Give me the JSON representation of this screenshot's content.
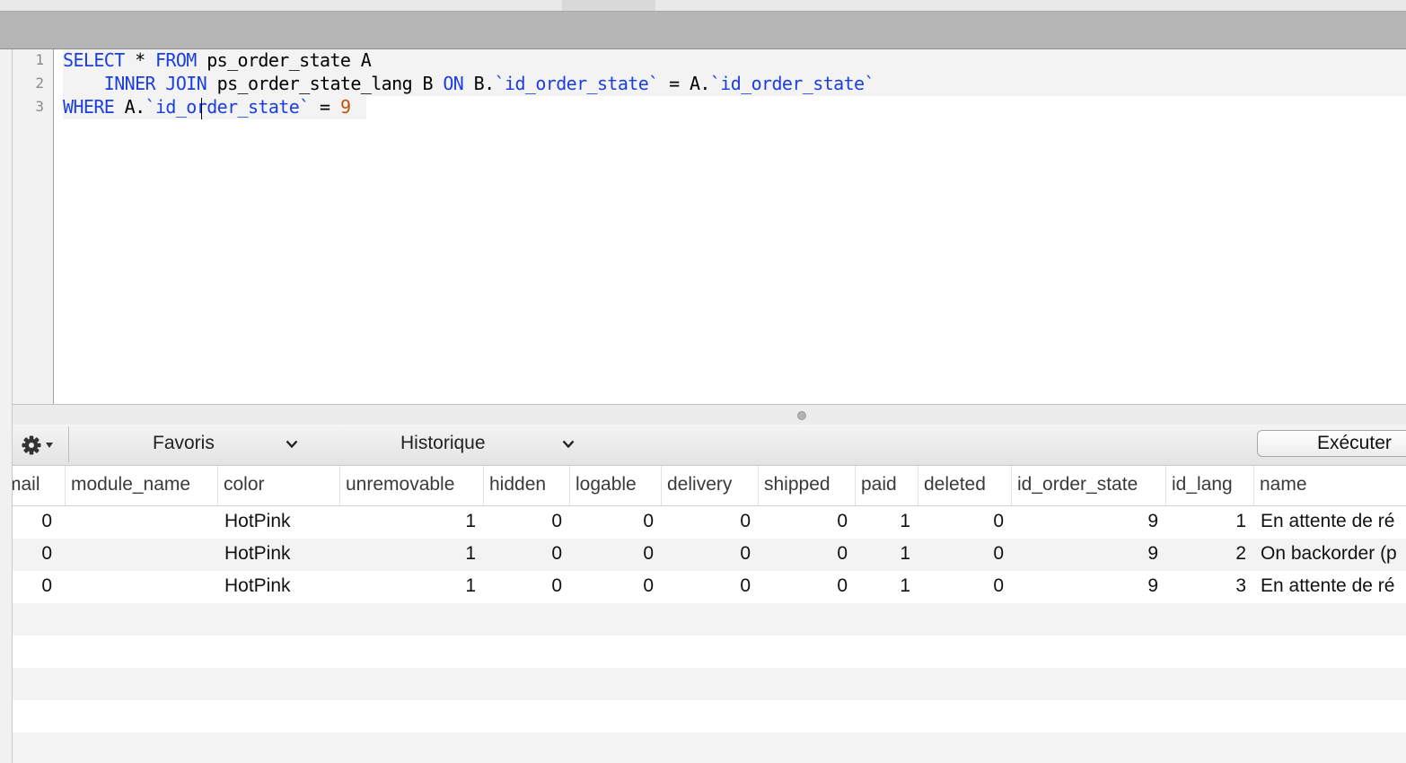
{
  "editor": {
    "line_numbers": [
      "1",
      "2",
      "3"
    ],
    "lines": [
      [
        {
          "t": "SELECT",
          "c": "kw"
        },
        {
          "t": " * ",
          "c": "tx"
        },
        {
          "t": "FROM",
          "c": "kw"
        },
        {
          "t": " ps_order_state A",
          "c": "tx"
        }
      ],
      [
        {
          "t": "    ",
          "c": "tx"
        },
        {
          "t": "INNER JOIN",
          "c": "kw"
        },
        {
          "t": " ps_order_state_lang B ",
          "c": "tx"
        },
        {
          "t": "ON",
          "c": "kw"
        },
        {
          "t": " B.",
          "c": "tx"
        },
        {
          "t": "`id_order_state`",
          "c": "bq"
        },
        {
          "t": " = A.",
          "c": "tx"
        },
        {
          "t": "`id_order_state`",
          "c": "bq"
        }
      ],
      [
        {
          "t": "WHERE",
          "c": "kw"
        },
        {
          "t": " A.",
          "c": "tx"
        },
        {
          "t": "`id_order_state`",
          "c": "bq"
        },
        {
          "t": " = ",
          "c": "tx"
        },
        {
          "t": "9",
          "c": "num"
        }
      ]
    ]
  },
  "toolbar": {
    "gear_icon": "gear-icon",
    "favorites_label": "Favoris",
    "history_label": "Historique",
    "run_label": "Exécuter"
  },
  "results": {
    "columns": [
      {
        "label": "mail",
        "align": "r"
      },
      {
        "label": "module_name",
        "align": "l"
      },
      {
        "label": "color",
        "align": "l"
      },
      {
        "label": "unremovable",
        "align": "r"
      },
      {
        "label": "hidden",
        "align": "r"
      },
      {
        "label": "logable",
        "align": "r"
      },
      {
        "label": "delivery",
        "align": "r"
      },
      {
        "label": "shipped",
        "align": "r"
      },
      {
        "label": "paid",
        "align": "r"
      },
      {
        "label": "deleted",
        "align": "r"
      },
      {
        "label": "id_order_state",
        "align": "r"
      },
      {
        "label": "id_lang",
        "align": "r"
      },
      {
        "label": "name",
        "align": "l"
      }
    ],
    "rows": [
      [
        "0",
        "",
        "HotPink",
        "1",
        "0",
        "0",
        "0",
        "0",
        "1",
        "0",
        "9",
        "1",
        "En attente de ré"
      ],
      [
        "0",
        "",
        "HotPink",
        "1",
        "0",
        "0",
        "0",
        "0",
        "1",
        "0",
        "9",
        "2",
        "On backorder (p"
      ],
      [
        "0",
        "",
        "HotPink",
        "1",
        "0",
        "0",
        "0",
        "0",
        "1",
        "0",
        "9",
        "3",
        "En attente de ré"
      ]
    ],
    "empty_rows": 5
  },
  "colors": {
    "keyword": "#1b3ee0",
    "number": "#c1500b",
    "row_stripe": "#f3f3f3"
  }
}
